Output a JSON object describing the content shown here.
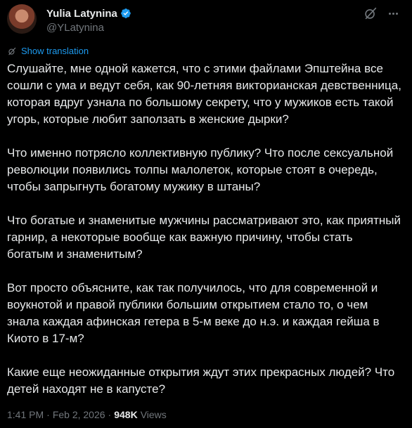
{
  "author": {
    "display_name": "Yulia Latynina",
    "handle": "@YLatynina",
    "verified": true
  },
  "colors": {
    "background": "#000000",
    "text": "#e7e9ea",
    "secondary": "#71767b",
    "accent": "#1d9bf0"
  },
  "actions": {
    "grok_icon": "grok-icon",
    "more_icon": "more-icon"
  },
  "translate_label": "Show translation",
  "paragraphs": [
    "Слушайте, мне одной кажется, что с этими файлами Эпштейна все сошли с ума и ведут себя, как 90-летняя викторианская девственница, которая вдруг узнала по большому секрету, что у мужиков есть такой угорь, которые любит заползать в женские дырки?",
    "Что именно потрясло коллективную публику? Что после сексуальной революции появились толпы малолеток, которые стоят в очередь, чтобы запрыгнуть богатому мужику в штаны?",
    "Что богатые и знаменитые мужчины рассматривают это, как приятный гарнир, а некоторые вообще как важную причину, чтобы стать богатым и знаменитым?",
    "Вот просто объясните, как так получилось, что для современной и воукнотой и правой публики большим открытием стало то, о чем знала каждая афинская гетера в 5-м веке до н.э. и каждая гейша в Киото в 17-м?",
    "Какие еще неожиданные открытия ждут этих прекрасных людей? Что детей находят не в капусте?"
  ],
  "meta": {
    "time": "1:41 PM",
    "separator": "·",
    "date": "Feb 2, 2026",
    "views_count": "948K",
    "views_label": "Views"
  }
}
